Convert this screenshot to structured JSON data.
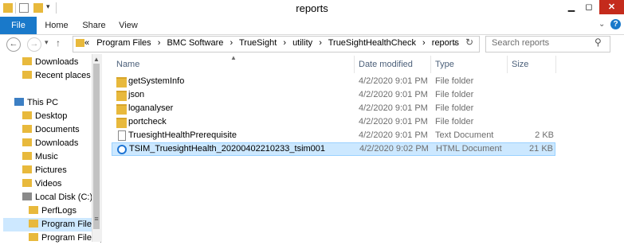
{
  "window": {
    "title": "reports"
  },
  "ribbon": {
    "tabs": [
      "File",
      "Home",
      "Share",
      "View"
    ]
  },
  "address": {
    "prefix": "«",
    "path": [
      "Program Files",
      "BMC Software",
      "TrueSight",
      "utility",
      "TrueSightHealthCheck",
      "reports"
    ],
    "separator": "›"
  },
  "search": {
    "placeholder": "Search reports"
  },
  "columns": {
    "name": "Name",
    "date": "Date modified",
    "type": "Type",
    "size": "Size"
  },
  "nav": {
    "items": [
      {
        "label": "Downloads",
        "icon": "downloads-icon"
      },
      {
        "label": "Recent places",
        "icon": "recent-places-icon"
      },
      {
        "label": "",
        "icon": ""
      },
      {
        "label": "This PC",
        "icon": "pc-icon"
      },
      {
        "label": "Desktop",
        "icon": "folder-icon"
      },
      {
        "label": "Documents",
        "icon": "folder-icon"
      },
      {
        "label": "Downloads",
        "icon": "folder-icon"
      },
      {
        "label": "Music",
        "icon": "folder-icon"
      },
      {
        "label": "Pictures",
        "icon": "folder-icon"
      },
      {
        "label": "Videos",
        "icon": "folder-icon"
      },
      {
        "label": "Local Disk (C:)",
        "icon": "drive-icon"
      },
      {
        "label": "PerfLogs",
        "icon": "folder-icon"
      },
      {
        "label": "Program Files",
        "icon": "folder-icon"
      },
      {
        "label": "Program Files (",
        "icon": "folder-icon"
      }
    ]
  },
  "files": [
    {
      "name": "getSystemInfo",
      "date": "4/2/2020 9:01 PM",
      "type": "File folder",
      "size": "",
      "icon": "folder-icon"
    },
    {
      "name": "json",
      "date": "4/2/2020 9:01 PM",
      "type": "File folder",
      "size": "",
      "icon": "folder-icon"
    },
    {
      "name": "loganalyser",
      "date": "4/2/2020 9:01 PM",
      "type": "File folder",
      "size": "",
      "icon": "folder-icon"
    },
    {
      "name": "portcheck",
      "date": "4/2/2020 9:01 PM",
      "type": "File folder",
      "size": "",
      "icon": "folder-icon"
    },
    {
      "name": "TruesightHealthPrerequisite",
      "date": "4/2/2020 9:01 PM",
      "type": "Text Document",
      "size": "2 KB",
      "icon": "text-file-icon"
    },
    {
      "name": "TSIM_TruesightHealth_20200402210233_tsim001",
      "date": "4/2/2020 9:02 PM",
      "type": "HTML Document",
      "size": "21 KB",
      "icon": "html-file-icon"
    }
  ]
}
